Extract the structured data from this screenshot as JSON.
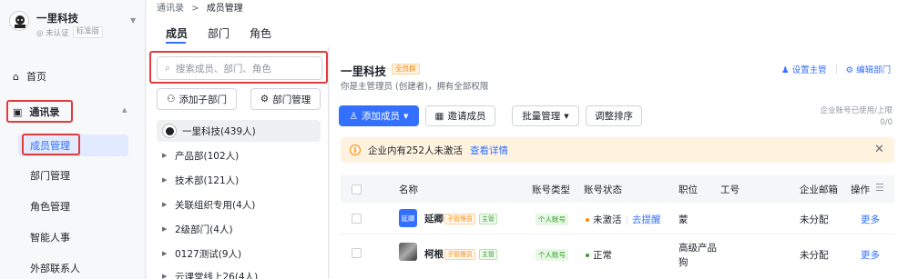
{
  "sidebar": {
    "org_name": "一里科技",
    "badge_unverified": "未认证",
    "badge_edition": "标准版",
    "items": [
      {
        "label": "首页"
      },
      {
        "label": "通讯录"
      },
      {
        "label": "成员管理"
      },
      {
        "label": "部门管理"
      },
      {
        "label": "角色管理"
      },
      {
        "label": "智能人事"
      },
      {
        "label": "外部联系人"
      }
    ]
  },
  "breadcrumb": {
    "root": "通讯录",
    "sep": ">",
    "current": "成员管理"
  },
  "tabs": [
    "成员",
    "部门",
    "角色"
  ],
  "tree": {
    "search_placeholder": "搜索成员、部门、角色",
    "add_sub_dept": "添加子部门",
    "dept_manage": "部门管理",
    "items": [
      {
        "label": "一里科技(439人)"
      },
      {
        "label": "产品部(102人)"
      },
      {
        "label": "技术部(121人)"
      },
      {
        "label": "关联组织专用(4人)"
      },
      {
        "label": "2级部门(4人)"
      },
      {
        "label": "0127测试(9人)"
      },
      {
        "label": "云课堂线上26(4人)"
      }
    ]
  },
  "main": {
    "title": "一里科技",
    "title_tag": "全员群",
    "subtitle": "你是主管理员 (创建者)，拥有全部权限",
    "set_manager": "设置主管",
    "edit_dept": "编辑部门",
    "add_member": "添加成员",
    "invite_member": "邀请成员",
    "batch_manage": "批量管理",
    "adjust_sort": "调整排序",
    "quota_label": "企业账号已使用/上限",
    "quota_value": "0/0",
    "banner_text": "企业内有252人未激活",
    "banner_link": "查看详情",
    "columns": [
      "名称",
      "账号类型",
      "账号状态",
      "职位",
      "工号",
      "企业邮箱",
      "操作"
    ],
    "rows": [
      {
        "avatar_text": "延卿",
        "name": "延卿",
        "tag1": "子管理员",
        "tag2": "主管",
        "acct_type": "个人账号",
        "status": "未激活",
        "status_action": "去提醒",
        "position": "蒙",
        "email": "未分配",
        "op": "更多"
      },
      {
        "name": "柯根",
        "tag1": "子管理员",
        "tag2": "主管",
        "acct_type": "个人账号",
        "status": "正常",
        "position": "高级产品狗",
        "email": "未分配",
        "op": "更多"
      }
    ]
  },
  "colors": {
    "accent": "#3370ff",
    "highlight": "#e33b3b",
    "warning_bg": "#fff3e0"
  }
}
